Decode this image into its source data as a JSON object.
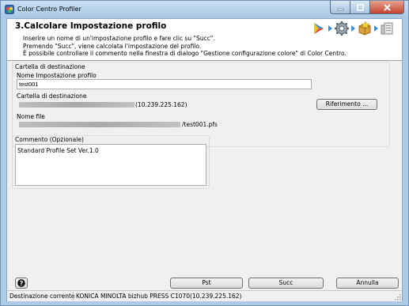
{
  "window": {
    "title": "Color Centro Profiler"
  },
  "header": {
    "step_title": "3.Calcolare Impostazione profilo",
    "lines": [
      "Inserire un nome di un'impostazione profilo e fare clic su \"Succ\".",
      "Premendo \"Succ\", viene calcolata l'impostazione del profilo.",
      "È possibile controllare il commento nella finestra di dialogo \"Gestione configurazione colore\" di Color Centro."
    ],
    "step_icons": [
      "print-step-icon",
      "gear-step-icon",
      "package-step-icon",
      "finish-step-icon"
    ]
  },
  "destination": {
    "group_label": "Cartella di destinazione",
    "name_label": "Nome Impostazione profilo",
    "name_value": "test001",
    "folder_label": "Cartella di destinazione",
    "folder_value": "(10.239.225.162)",
    "browse_button": "Riferimento ...",
    "file_label": "Nome file",
    "file_value": "/test001.pfs"
  },
  "comment": {
    "label": "Commento (Opzionale)",
    "value": "Standard Profile Set Ver.1.0"
  },
  "footer": {
    "help_label": "?",
    "prev_button": "Pst",
    "next_button": "Succ",
    "cancel_button": "Annulla"
  },
  "status": {
    "label": "Destinazione corrente",
    "value": "KONICA MINOLTA bizhub PRESS C1070(10.239.225.162)"
  }
}
